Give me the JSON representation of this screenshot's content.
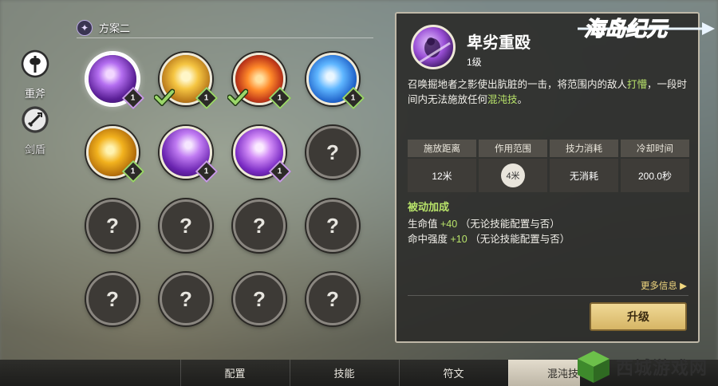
{
  "categories": [
    {
      "label": "重斧",
      "icon": "axe-icon",
      "active": true
    },
    {
      "label": "剑盾",
      "icon": "sword-shield-icon",
      "active": false
    }
  ],
  "plan": {
    "label": "方案二",
    "icon": "sparkle-icon"
  },
  "skills": [
    {
      "state": "unlocked",
      "level": "1",
      "equipped": false,
      "selected": true,
      "art": "purple-earth"
    },
    {
      "state": "unlocked",
      "level": "1",
      "equipped": true,
      "art": "gold-crown"
    },
    {
      "state": "unlocked",
      "level": "1",
      "equipped": true,
      "art": "fire"
    },
    {
      "state": "unlocked",
      "level": "1",
      "equipped": false,
      "art": "blue-wave"
    },
    {
      "state": "unlocked",
      "level": "1",
      "equipped": false,
      "art": "gold-beast"
    },
    {
      "state": "unlocked",
      "level": "1",
      "equipped": false,
      "art": "purple-wolf"
    },
    {
      "state": "unlocked",
      "level": "1",
      "equipped": false,
      "art": "purple-orbs"
    },
    {
      "state": "locked",
      "mark": "?"
    },
    {
      "state": "locked",
      "mark": "?"
    },
    {
      "state": "locked",
      "mark": "?"
    },
    {
      "state": "locked",
      "mark": "?"
    },
    {
      "state": "locked",
      "mark": "?"
    },
    {
      "state": "locked",
      "mark": "?"
    },
    {
      "state": "locked",
      "mark": "?"
    },
    {
      "state": "locked",
      "mark": "?"
    },
    {
      "state": "locked",
      "mark": "?"
    }
  ],
  "detail": {
    "name": "卑劣重殴",
    "level": "1级",
    "desc_part1": "召唤掘地者之影使出肮脏的一击，将范围内的敌人",
    "desc_hl1": "打懵",
    "desc_part2": "，一段时间内无法施放任何",
    "desc_hl2": "混沌技",
    "desc_part3": "。",
    "stats": [
      {
        "label": "施放距离",
        "value": "12米"
      },
      {
        "label": "作用范围",
        "value": "4米"
      },
      {
        "label": "技力消耗",
        "value": "无消耗"
      },
      {
        "label": "冷却时间",
        "value": "200.0秒"
      }
    ],
    "passive_title": "被动加成",
    "passives": [
      {
        "label": "生命值",
        "value": "+40",
        "note": "（无论技能配置与否）"
      },
      {
        "label": "命中强度",
        "value": "+10",
        "note": "（无论技能配置与否）"
      }
    ],
    "more": "更多信息",
    "upgrade": "升级"
  },
  "logo_text": "海岛纪元",
  "tabs": [
    {
      "label": "配置",
      "active": false
    },
    {
      "label": "技能",
      "active": false
    },
    {
      "label": "符文",
      "active": false
    },
    {
      "label": "混沌技",
      "active": true
    }
  ],
  "watermark": "西城游戏网",
  "colors": {
    "highlight": "#b8e36a",
    "gold": "#f2d880",
    "equipped": "#9bd76a"
  }
}
